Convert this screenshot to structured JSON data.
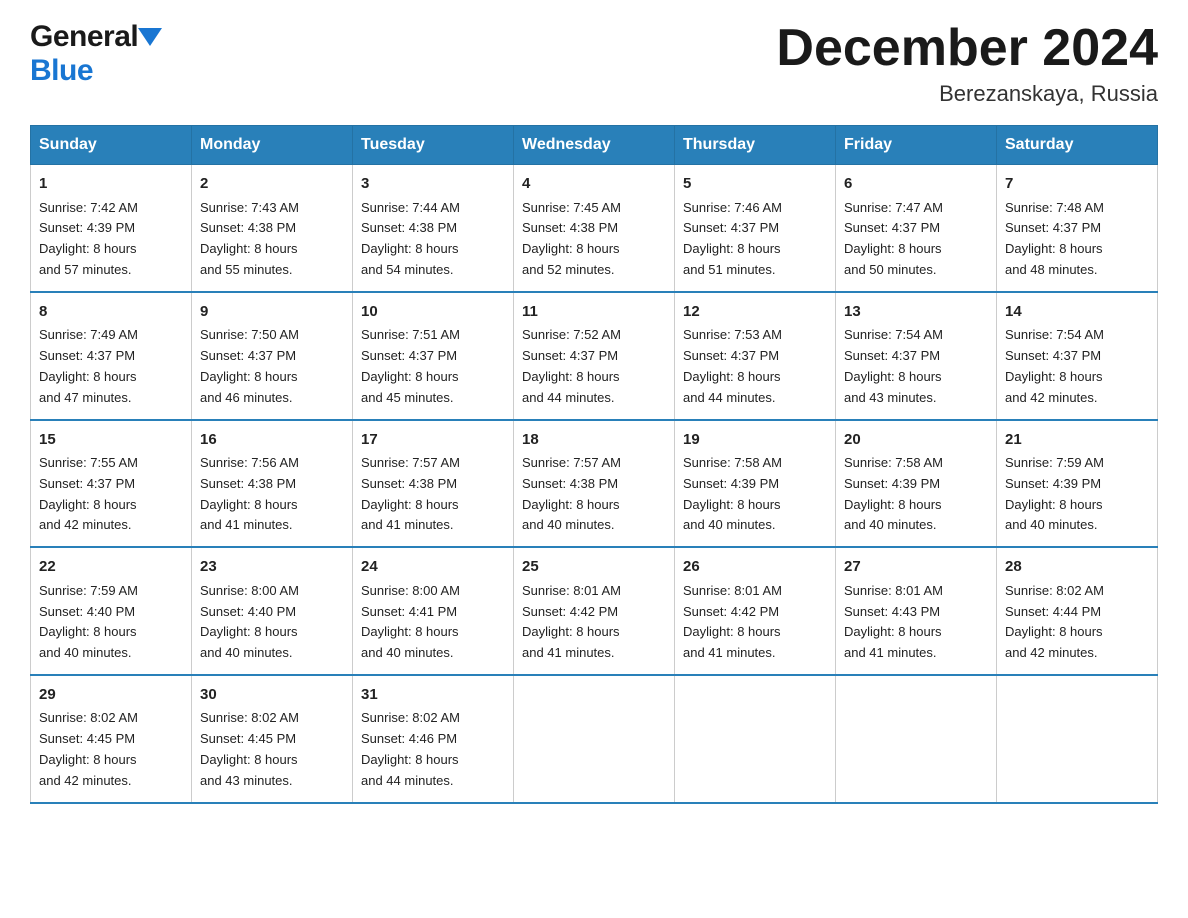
{
  "header": {
    "logo_general": "General",
    "logo_blue": "Blue",
    "month_title": "December 2024",
    "location": "Berezanskaya, Russia"
  },
  "days_of_week": [
    "Sunday",
    "Monday",
    "Tuesday",
    "Wednesday",
    "Thursday",
    "Friday",
    "Saturday"
  ],
  "weeks": [
    [
      {
        "num": "1",
        "sunrise": "7:42 AM",
        "sunset": "4:39 PM",
        "daylight": "8 hours and 57 minutes."
      },
      {
        "num": "2",
        "sunrise": "7:43 AM",
        "sunset": "4:38 PM",
        "daylight": "8 hours and 55 minutes."
      },
      {
        "num": "3",
        "sunrise": "7:44 AM",
        "sunset": "4:38 PM",
        "daylight": "8 hours and 54 minutes."
      },
      {
        "num": "4",
        "sunrise": "7:45 AM",
        "sunset": "4:38 PM",
        "daylight": "8 hours and 52 minutes."
      },
      {
        "num": "5",
        "sunrise": "7:46 AM",
        "sunset": "4:37 PM",
        "daylight": "8 hours and 51 minutes."
      },
      {
        "num": "6",
        "sunrise": "7:47 AM",
        "sunset": "4:37 PM",
        "daylight": "8 hours and 50 minutes."
      },
      {
        "num": "7",
        "sunrise": "7:48 AM",
        "sunset": "4:37 PM",
        "daylight": "8 hours and 48 minutes."
      }
    ],
    [
      {
        "num": "8",
        "sunrise": "7:49 AM",
        "sunset": "4:37 PM",
        "daylight": "8 hours and 47 minutes."
      },
      {
        "num": "9",
        "sunrise": "7:50 AM",
        "sunset": "4:37 PM",
        "daylight": "8 hours and 46 minutes."
      },
      {
        "num": "10",
        "sunrise": "7:51 AM",
        "sunset": "4:37 PM",
        "daylight": "8 hours and 45 minutes."
      },
      {
        "num": "11",
        "sunrise": "7:52 AM",
        "sunset": "4:37 PM",
        "daylight": "8 hours and 44 minutes."
      },
      {
        "num": "12",
        "sunrise": "7:53 AM",
        "sunset": "4:37 PM",
        "daylight": "8 hours and 44 minutes."
      },
      {
        "num": "13",
        "sunrise": "7:54 AM",
        "sunset": "4:37 PM",
        "daylight": "8 hours and 43 minutes."
      },
      {
        "num": "14",
        "sunrise": "7:54 AM",
        "sunset": "4:37 PM",
        "daylight": "8 hours and 42 minutes."
      }
    ],
    [
      {
        "num": "15",
        "sunrise": "7:55 AM",
        "sunset": "4:37 PM",
        "daylight": "8 hours and 42 minutes."
      },
      {
        "num": "16",
        "sunrise": "7:56 AM",
        "sunset": "4:38 PM",
        "daylight": "8 hours and 41 minutes."
      },
      {
        "num": "17",
        "sunrise": "7:57 AM",
        "sunset": "4:38 PM",
        "daylight": "8 hours and 41 minutes."
      },
      {
        "num": "18",
        "sunrise": "7:57 AM",
        "sunset": "4:38 PM",
        "daylight": "8 hours and 40 minutes."
      },
      {
        "num": "19",
        "sunrise": "7:58 AM",
        "sunset": "4:39 PM",
        "daylight": "8 hours and 40 minutes."
      },
      {
        "num": "20",
        "sunrise": "7:58 AM",
        "sunset": "4:39 PM",
        "daylight": "8 hours and 40 minutes."
      },
      {
        "num": "21",
        "sunrise": "7:59 AM",
        "sunset": "4:39 PM",
        "daylight": "8 hours and 40 minutes."
      }
    ],
    [
      {
        "num": "22",
        "sunrise": "7:59 AM",
        "sunset": "4:40 PM",
        "daylight": "8 hours and 40 minutes."
      },
      {
        "num": "23",
        "sunrise": "8:00 AM",
        "sunset": "4:40 PM",
        "daylight": "8 hours and 40 minutes."
      },
      {
        "num": "24",
        "sunrise": "8:00 AM",
        "sunset": "4:41 PM",
        "daylight": "8 hours and 40 minutes."
      },
      {
        "num": "25",
        "sunrise": "8:01 AM",
        "sunset": "4:42 PM",
        "daylight": "8 hours and 41 minutes."
      },
      {
        "num": "26",
        "sunrise": "8:01 AM",
        "sunset": "4:42 PM",
        "daylight": "8 hours and 41 minutes."
      },
      {
        "num": "27",
        "sunrise": "8:01 AM",
        "sunset": "4:43 PM",
        "daylight": "8 hours and 41 minutes."
      },
      {
        "num": "28",
        "sunrise": "8:02 AM",
        "sunset": "4:44 PM",
        "daylight": "8 hours and 42 minutes."
      }
    ],
    [
      {
        "num": "29",
        "sunrise": "8:02 AM",
        "sunset": "4:45 PM",
        "daylight": "8 hours and 42 minutes."
      },
      {
        "num": "30",
        "sunrise": "8:02 AM",
        "sunset": "4:45 PM",
        "daylight": "8 hours and 43 minutes."
      },
      {
        "num": "31",
        "sunrise": "8:02 AM",
        "sunset": "4:46 PM",
        "daylight": "8 hours and 44 minutes."
      },
      null,
      null,
      null,
      null
    ]
  ],
  "labels": {
    "sunrise": "Sunrise:",
    "sunset": "Sunset:",
    "daylight": "Daylight:"
  }
}
